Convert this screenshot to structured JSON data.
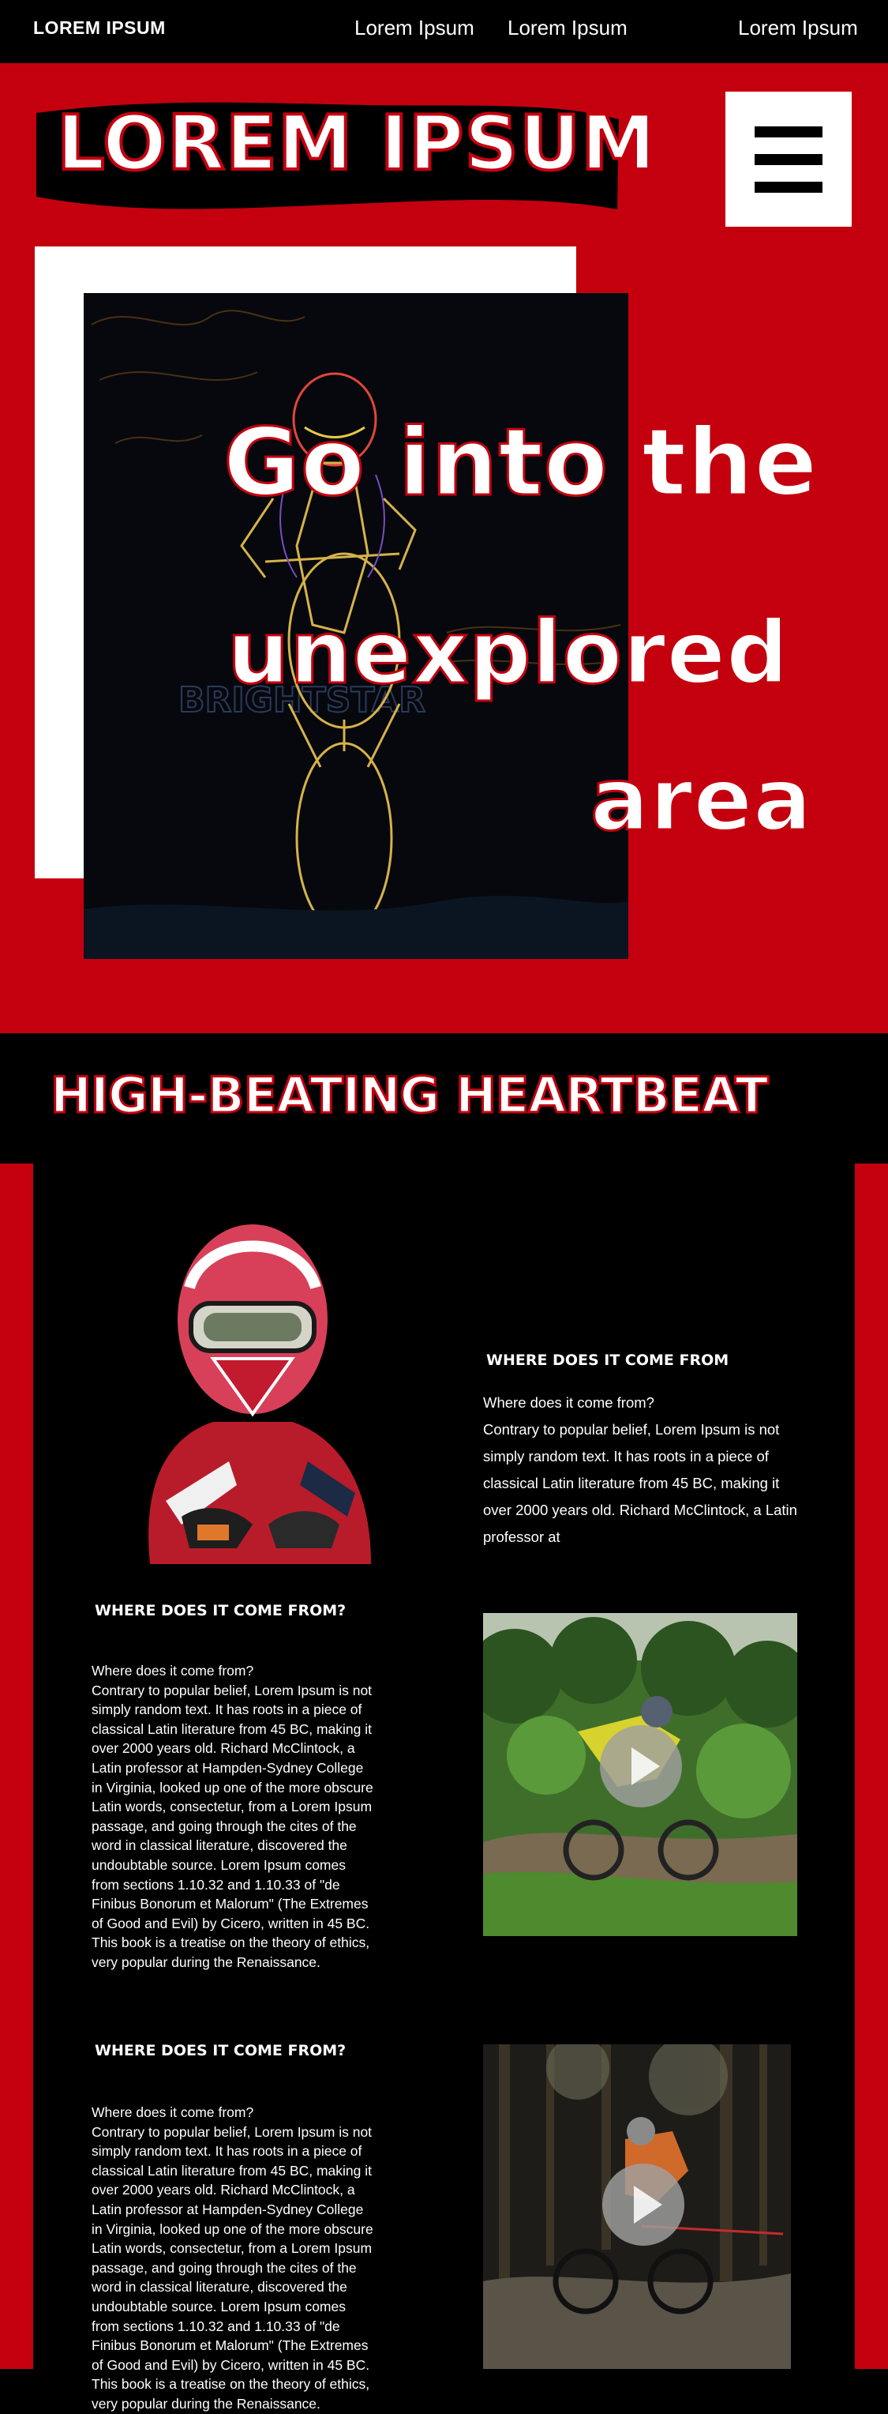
{
  "nav": {
    "brand": "LOREM IPSUM",
    "links": [
      "Lorem Ipsum",
      "Lorem Ipsum",
      "Lorem Ipsum"
    ]
  },
  "hero": {
    "logo": "LOREM IPSUM",
    "headline": [
      "Go into the",
      "unexplored",
      "area"
    ]
  },
  "section": {
    "title": "HIGH-BEATING HEARTBEAT"
  },
  "features": [
    {
      "heading": "WHERE DOES IT COME FROM",
      "question": "Where does it come from?",
      "body": "Contrary to popular belief, Lorem Ipsum is not simply random text. It has roots in a piece of classical Latin literature from 45 BC, making it over 2000 years old. Richard McClintock, a Latin professor at"
    },
    {
      "heading": "WHERE DOES IT COME FROM?",
      "question": "Where does it come from?",
      "body": "Contrary to popular belief, Lorem Ipsum is not simply random text. It has roots in a piece of classical Latin literature from 45 BC, making it over 2000 years old. Richard McClintock, a Latin professor at Hampden-Sydney College in Virginia, looked up one of the more obscure Latin words, consectetur, from a Lorem Ipsum passage, and going through the cites of the word in classical literature, discovered the undoubtable source. Lorem Ipsum comes from sections 1.10.32 and 1.10.33 of \"de Finibus Bonorum et Malorum\" (The Extremes of Good and Evil) by Cicero, written in 45 BC. This book is a treatise on the theory of ethics, very popular during the Renaissance."
    },
    {
      "heading": "WHERE DOES IT COME FROM?",
      "question": "Where does it come from?",
      "body": "Contrary to popular belief, Lorem Ipsum is not simply random text. It has roots in a piece of classical Latin literature from 45 BC, making it over 2000 years old. Richard McClintock, a Latin professor at Hampden-Sydney College in Virginia, looked up one of the more obscure Latin words, consectetur, from a Lorem Ipsum passage, and going through the cites of the word in classical literature, discovered the undoubtable source. Lorem Ipsum comes from sections 1.10.32 and 1.10.33 of \"de Finibus Bonorum et Malorum\" (The Extremes of Good and Evil) by Cicero, written in 45 BC. This book is a treatise on the theory of ethics, very popular during the Renaissance."
    }
  ],
  "colors": {
    "brand_red": "#c4000f",
    "background": "#000000",
    "text": "#ffffff"
  },
  "icons": [
    "hamburger-menu-icon",
    "play-icon"
  ]
}
